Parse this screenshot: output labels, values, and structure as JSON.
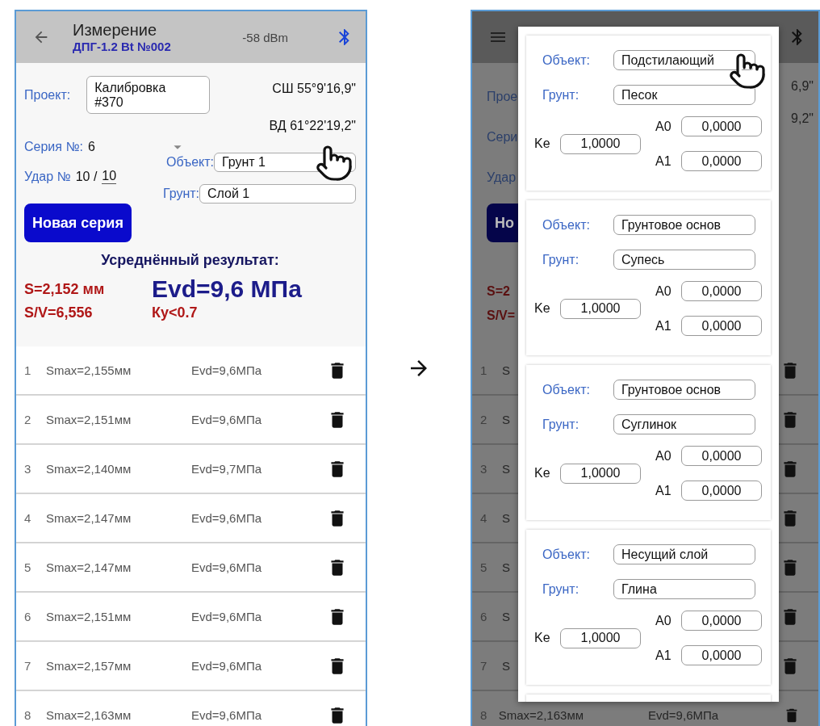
{
  "left": {
    "header": {
      "title": "Измерение",
      "subtitle": "ДПГ-1.2 Bt №002",
      "signal": "-58 dBm"
    },
    "project_label": "Проект:",
    "project": "Калибровка #370",
    "latitude": "СШ 55°9'16,9\"",
    "longitude": "ВД 61°22'19,2\"",
    "series_label": "Серия №:",
    "series": "6",
    "strike_label": "Удар №",
    "strike": "10 /",
    "strike_total": "10",
    "object_label": "Объект:",
    "object": "Грунт 1",
    "soil_label": "Грунт:",
    "soil": "Слой 1",
    "new_series_button": "Новая серия",
    "average_title": "Усреднённый результат:",
    "s": "S=2,152 мм",
    "evd": "Evd=9,6 МПа",
    "sv": "S/V=6,556",
    "ky": "Ку<0.7",
    "rows": [
      {
        "number": "1",
        "smax": "Smax=2,155мм",
        "evd": "Evd=9,6МПа"
      },
      {
        "number": "2",
        "smax": "Smax=2,151мм",
        "evd": "Evd=9,6МПа"
      },
      {
        "number": "3",
        "smax": "Smax=2,140мм",
        "evd": "Evd=9,7МПа"
      },
      {
        "number": "4",
        "smax": "Smax=2,147мм",
        "evd": "Evd=9,6МПа"
      },
      {
        "number": "5",
        "smax": "Smax=2,147мм",
        "evd": "Evd=9,6МПа"
      },
      {
        "number": "6",
        "smax": "Smax=2,151мм",
        "evd": "Evd=9,6МПа"
      },
      {
        "number": "7",
        "smax": "Smax=2,157мм",
        "evd": "Evd=9,6МПа"
      },
      {
        "number": "8",
        "smax": "Smax=2,163мм",
        "evd": "Evd=9,6МПа"
      }
    ]
  },
  "right": {
    "background": {
      "labels": [
        "Прое",
        "Сери",
        "Удар"
      ],
      "button": "Но",
      "coords": [
        "6,9\"",
        "9,2\""
      ],
      "results": [
        "S=2",
        "S/V="
      ],
      "rows": [
        {
          "number": "1",
          "text": "S"
        },
        {
          "number": "2",
          "text": "S"
        },
        {
          "number": "3",
          "text": "S"
        },
        {
          "number": "4",
          "text": "S"
        },
        {
          "number": "5",
          "text": "S"
        },
        {
          "number": "6",
          "text": "S"
        },
        {
          "number": "7",
          "text": "S"
        },
        {
          "number": "8",
          "text": "Smax=2,163мм",
          "evd": "Evd=9,6МПа"
        }
      ]
    },
    "dialog": {
      "groups": [
        {
          "object_label": "Объект:",
          "object": "Подстилающий",
          "soil_label": "Грунт:",
          "soil": "Песок",
          "ke_label": "Ke",
          "ke": "1,0000",
          "a0_label": "A0",
          "a0": "0,0000",
          "a1_label": "A1",
          "a1": "0,0000"
        },
        {
          "object_label": "Объект:",
          "object": "Грунтовое основ",
          "soil_label": "Грунт:",
          "soil": "Супесь",
          "ke_label": "Ke",
          "ke": "1,0000",
          "a0_label": "A0",
          "a0": "0,0000",
          "a1_label": "A1",
          "a1": "0,0000"
        },
        {
          "object_label": "Объект:",
          "object": "Грунтовое основ",
          "soil_label": "Грунт:",
          "soil": "Суглинок",
          "ke_label": "Ke",
          "ke": "1,0000",
          "a0_label": "A0",
          "a0": "0,0000",
          "a1_label": "A1",
          "a1": "0,0000"
        },
        {
          "object_label": "Объект:",
          "object": "Несущий слой",
          "soil_label": "Грунт:",
          "soil": "Глина",
          "ke_label": "Ke",
          "ke": "1,0000",
          "a0_label": "A0",
          "a0": "0,0000",
          "a1_label": "A1",
          "a1": "0,0000"
        }
      ]
    }
  }
}
